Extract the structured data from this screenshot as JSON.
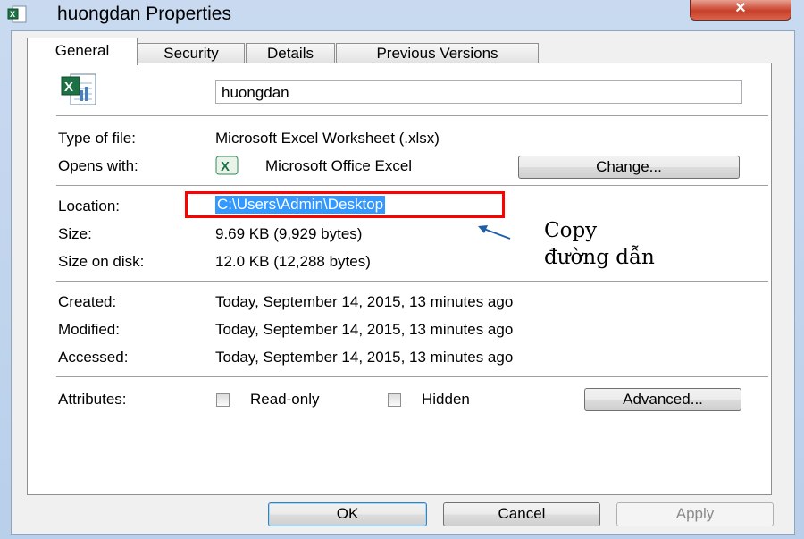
{
  "window": {
    "title": "huongdan Properties",
    "close_glyph": "✕"
  },
  "tabs": [
    {
      "label": "General",
      "active": true
    },
    {
      "label": "Security"
    },
    {
      "label": "Details"
    },
    {
      "label": "Previous Versions"
    }
  ],
  "general": {
    "file_name": "huongdan",
    "type_label": "Type of file:",
    "type_value": "Microsoft Excel Worksheet (.xlsx)",
    "opens_label": "Opens with:",
    "opens_value": "Microsoft Office Excel",
    "change_button": "Change...",
    "location_label": "Location:",
    "location_value": "C:\\Users\\Admin\\Desktop",
    "size_label": "Size:",
    "size_value": "9.69 KB (9,929 bytes)",
    "size_on_disk_label": "Size on disk:",
    "size_on_disk_value": "12.0 KB (12,288 bytes)",
    "created_label": "Created:",
    "created_value": "Today, September 14, 2015, 13 minutes ago",
    "modified_label": "Modified:",
    "modified_value": "Today, September 14, 2015, 13 minutes ago",
    "accessed_label": "Accessed:",
    "accessed_value": "Today, September 14, 2015, 13 minutes ago",
    "attributes_label": "Attributes:",
    "readonly_label": "Read-only",
    "hidden_label": "Hidden",
    "advanced_button": "Advanced..."
  },
  "annotation": {
    "line1": "Copy",
    "line2": "đường dẫn"
  },
  "footer": {
    "ok": "OK",
    "cancel": "Cancel",
    "apply": "Apply"
  },
  "colors": {
    "selection": "#3399ff",
    "highlight_box": "#ff0000",
    "arrow": "#1f5fa8"
  },
  "icons": {
    "title": "excel-file-icon",
    "file": "excel-worksheet-icon",
    "app": "excel-app-icon"
  }
}
